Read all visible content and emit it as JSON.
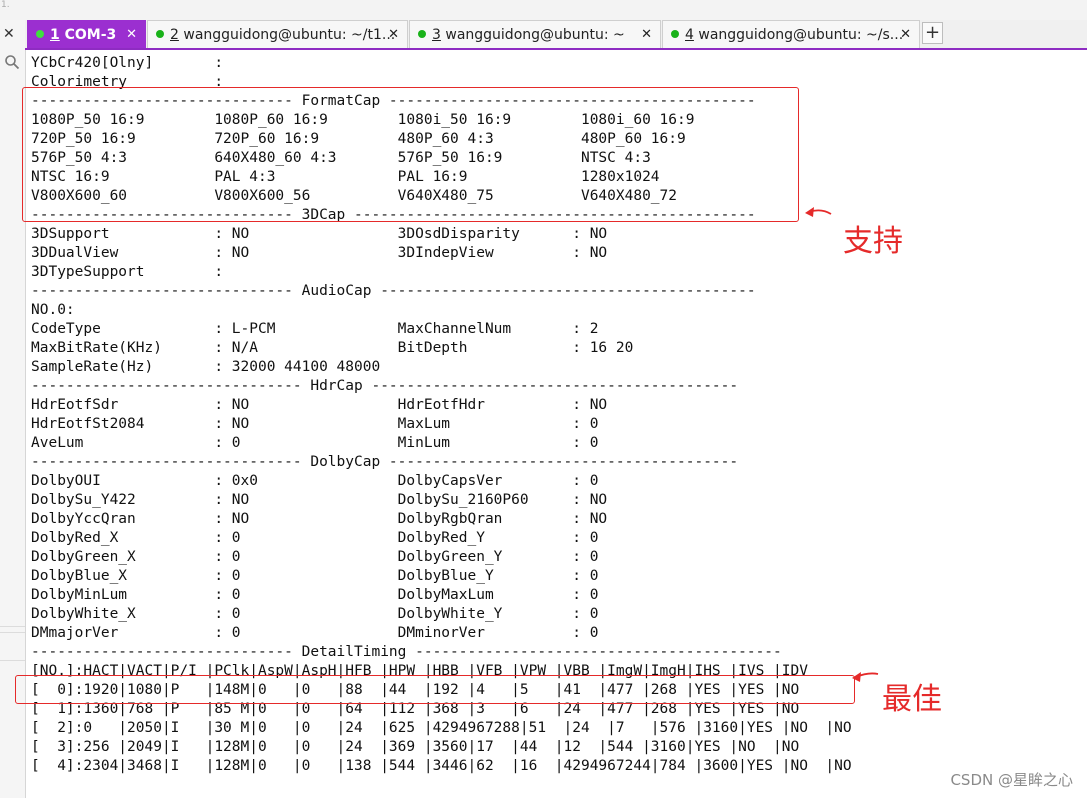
{
  "corner_mark": "1.",
  "tabs": [
    {
      "num": "1",
      "title": " COM-3",
      "active": true
    },
    {
      "num": "2",
      "title": " wangguidong@ubuntu: ~/t1...",
      "active": false
    },
    {
      "num": "3",
      "title": " wangguidong@ubuntu: ~",
      "active": false
    },
    {
      "num": "4",
      "title": " wangguidong@ubuntu: ~/s...",
      "active": false
    }
  ],
  "new_tab_label": "+",
  "terminal_lines": [
    "YCbCr420[Olny]       :",
    "Colorimetry          :",
    "------------------------------ FormatCap ------------------------------------------",
    "1080P_50 16:9        1080P_60 16:9        1080i_50 16:9        1080i_60 16:9",
    "720P_50 16:9         720P_60 16:9         480P_60 4:3          480P_60 16:9",
    "576P_50 4:3          640X480_60 4:3       576P_50 16:9         NTSC 4:3",
    "NTSC 16:9            PAL 4:3              PAL 16:9             1280x1024",
    "V800X600_60          V800X600_56          V640X480_75          V640X480_72",
    "------------------------------ 3DCap ----------------------------------------------",
    "3DSupport            : NO                 3DOsdDisparity      : NO",
    "3DDualView           : NO                 3DIndepView         : NO",
    "3DTypeSupport        :",
    "------------------------------ AudioCap -------------------------------------------",
    "NO.0:",
    "CodeType             : L-PCM              MaxChannelNum       : 2",
    "MaxBitRate(KHz)      : N/A                BitDepth            : 16 20",
    "SampleRate(Hz)       : 32000 44100 48000",
    "------------------------------- HdrCap ------------------------------------------",
    "HdrEotfSdr           : NO                 HdrEotfHdr          : NO",
    "HdrEotfSt2084        : NO                 MaxLum              : 0",
    "AveLum               : 0                  MinLum              : 0",
    "------------------------------- DolbyCap ----------------------------------------",
    "DolbyOUI             : 0x0                DolbyCapsVer        : 0",
    "DolbySu_Y422         : NO                 DolbySu_2160P60     : NO",
    "DolbyYccQran         : NO                 DolbyRgbQran        : NO",
    "DolbyRed_X           : 0                  DolbyRed_Y          : 0",
    "DolbyGreen_X         : 0                  DolbyGreen_Y        : 0",
    "DolbyBlue_X          : 0                  DolbyBlue_Y         : 0",
    "DolbyMinLum          : 0                  DolbyMaxLum         : 0",
    "DolbyWhite_X         : 0                  DolbyWhite_Y        : 0",
    "DMmajorVer           : 0                  DMminorVer          : 0",
    "------------------------------ DetailTiming ------------------------------------------",
    "[NO.]:HACT|VACT|P/I |PClk|AspW|AspH|HFB |HPW |HBB |VFB |VPW |VBB |ImgW|ImgH|IHS |IVS |IDV",
    "[  0]:1920|1080|P   |148M|0   |0   |88  |44  |192 |4   |5   |41  |477 |268 |YES |YES |NO",
    "[  1]:1360|768 |P   |85 M|0   |0   |64  |112 |368 |3   |6   |24  |477 |268 |YES |YES |NO",
    "[  2]:0   |2050|I   |30 M|0   |0   |24  |625 |4294967288|51  |24  |7   |576 |3160|YES |NO  |NO",
    "[  3]:256 |2049|I   |128M|0   |0   |24  |369 |3560|17  |44  |12  |544 |3160|YES |NO  |NO",
    "[  4]:2304|3468|I   |128M|0   |0   |138 |544 |3446|62  |16  |4294967244|784 |3600|YES |NO  |NO"
  ],
  "annotations": {
    "support_label": "支持",
    "best_label": "最佳",
    "color": "#e52a2a"
  },
  "watermark": "CSDN @星眸之心",
  "colors": {
    "tab_active": "#9b2fd0",
    "tab_underline": "#8e2cc2",
    "status_dot": "#19b219"
  }
}
